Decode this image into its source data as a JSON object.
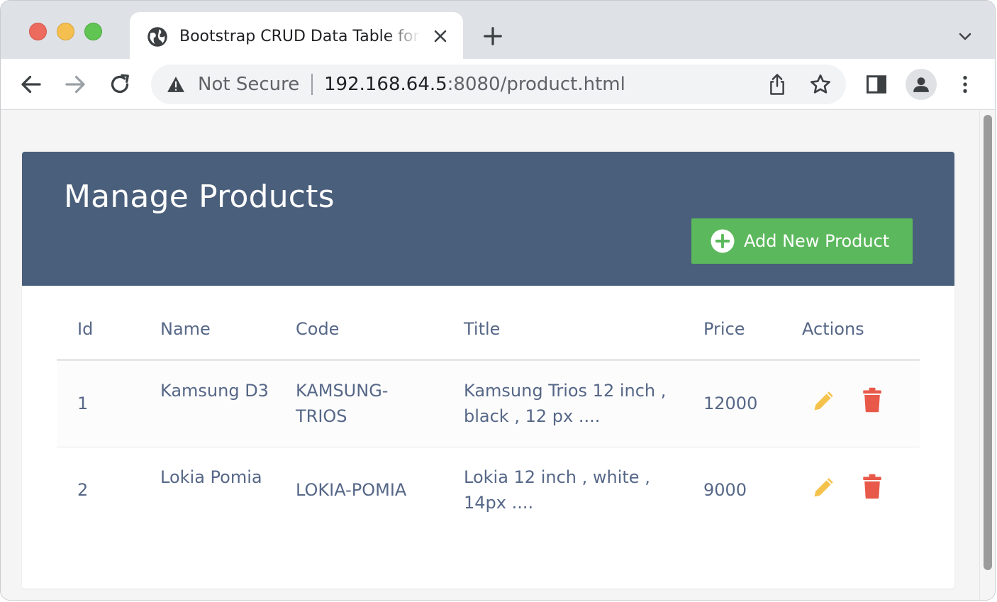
{
  "browser": {
    "tab_title": "Bootstrap CRUD Data Table for Database with Modal Form",
    "security_label": "Not Secure",
    "url_host": "192.168.64.5",
    "url_rest": ":8080/product.html"
  },
  "page": {
    "title": "Manage Products",
    "add_button_label": "Add New Product",
    "colors": {
      "header_bg": "#4a5f7b",
      "add_button": "#5cb85c",
      "edit_icon": "#f5c24b",
      "delete_icon": "#e8594a"
    }
  },
  "table": {
    "columns": [
      "Id",
      "Name",
      "Code",
      "Title",
      "Price",
      "Actions"
    ],
    "rows": [
      {
        "id": "1",
        "name": "Kamsung D3",
        "code": "KAMSUNG-TRIOS",
        "title": "Kamsung Trios 12 inch , black , 12 px ....",
        "price": "12000",
        "actions": [
          "pencil-icon",
          "trash-icon"
        ]
      },
      {
        "id": "2",
        "name": "Lokia Pomia",
        "code": "LOKIA-POMIA",
        "title": "Lokia 12 inch , white , 14px ....",
        "price": "9000",
        "actions": [
          "pencil-icon",
          "trash-icon"
        ]
      }
    ]
  }
}
